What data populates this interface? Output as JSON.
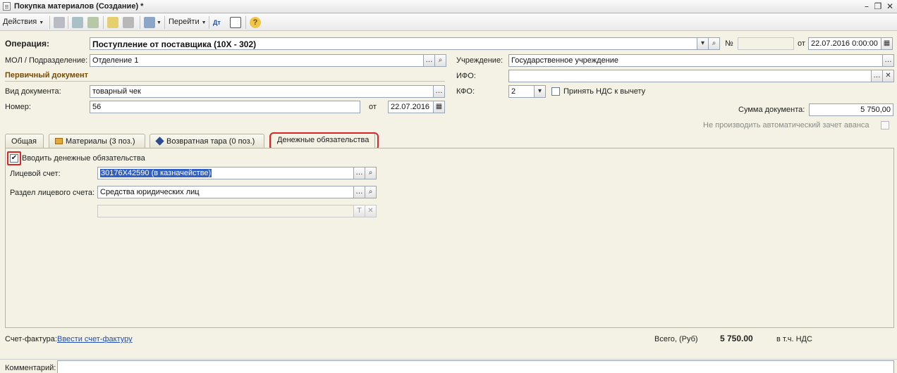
{
  "window": {
    "title": "Покупка материалов (Создание) *"
  },
  "toolbar": {
    "actions_label": "Действия",
    "goto_label": "Перейти"
  },
  "header": {
    "operation_label": "Операция:",
    "operation_value": "Поступление от поставщика (10Х - 302)",
    "number_label": "№",
    "number_value": "",
    "date_label": "от",
    "date_value": "22.07.2016  0:00:00",
    "mol_label": "МОЛ / Подразделение:",
    "mol_value": "Отделение 1",
    "institution_label": "Учреждение:",
    "institution_value": "Государственное учреждение",
    "ifo_label": "ИФО:",
    "ifo_value": "",
    "kfo_label": "КФО:",
    "kfo_value": "2",
    "vat_deduct_label": "Принять НДС к вычету",
    "sum_label": "Сумма документа:",
    "sum_value": "5 750,00",
    "no_auto_offset_label": "Не производить автоматический зачет аванса"
  },
  "primary_doc": {
    "section_title": "Первичный документ",
    "doc_type_label": "Вид документа:",
    "doc_type_value": "товарный чек",
    "number_label": "Номер:",
    "number_value": "56",
    "date_label": "от",
    "date_value": "22.07.2016"
  },
  "tabs": [
    {
      "label": "Общая"
    },
    {
      "label": "Материалы (3 поз.)"
    },
    {
      "label": "Возвратная тара (0 поз.)"
    },
    {
      "label": "Денежные обязательства"
    }
  ],
  "obligations": {
    "enter_label": "Вводить денежные обязательства",
    "enter_checked": true,
    "account_label": "Лицевой счет:",
    "account_value": "30176Х42590 (в казначействе)",
    "section_label": "Раздел лицевого счета:",
    "section_value": "Средства юридических лиц",
    "extra_value": ""
  },
  "footer": {
    "invoice_label": "Счет-фактура:",
    "invoice_link": "Ввести счет-фактуру",
    "total_label": "Всего, (Руб)",
    "total_value": "5 750.00",
    "vat_label": "в т.ч. НДС",
    "comment_label": "Комментарий:",
    "comment_value": ""
  },
  "colors": {
    "highlight": "#d8262a",
    "section": "#7a4b00",
    "link": "#1f4fb2",
    "selection": "#3160c4"
  }
}
